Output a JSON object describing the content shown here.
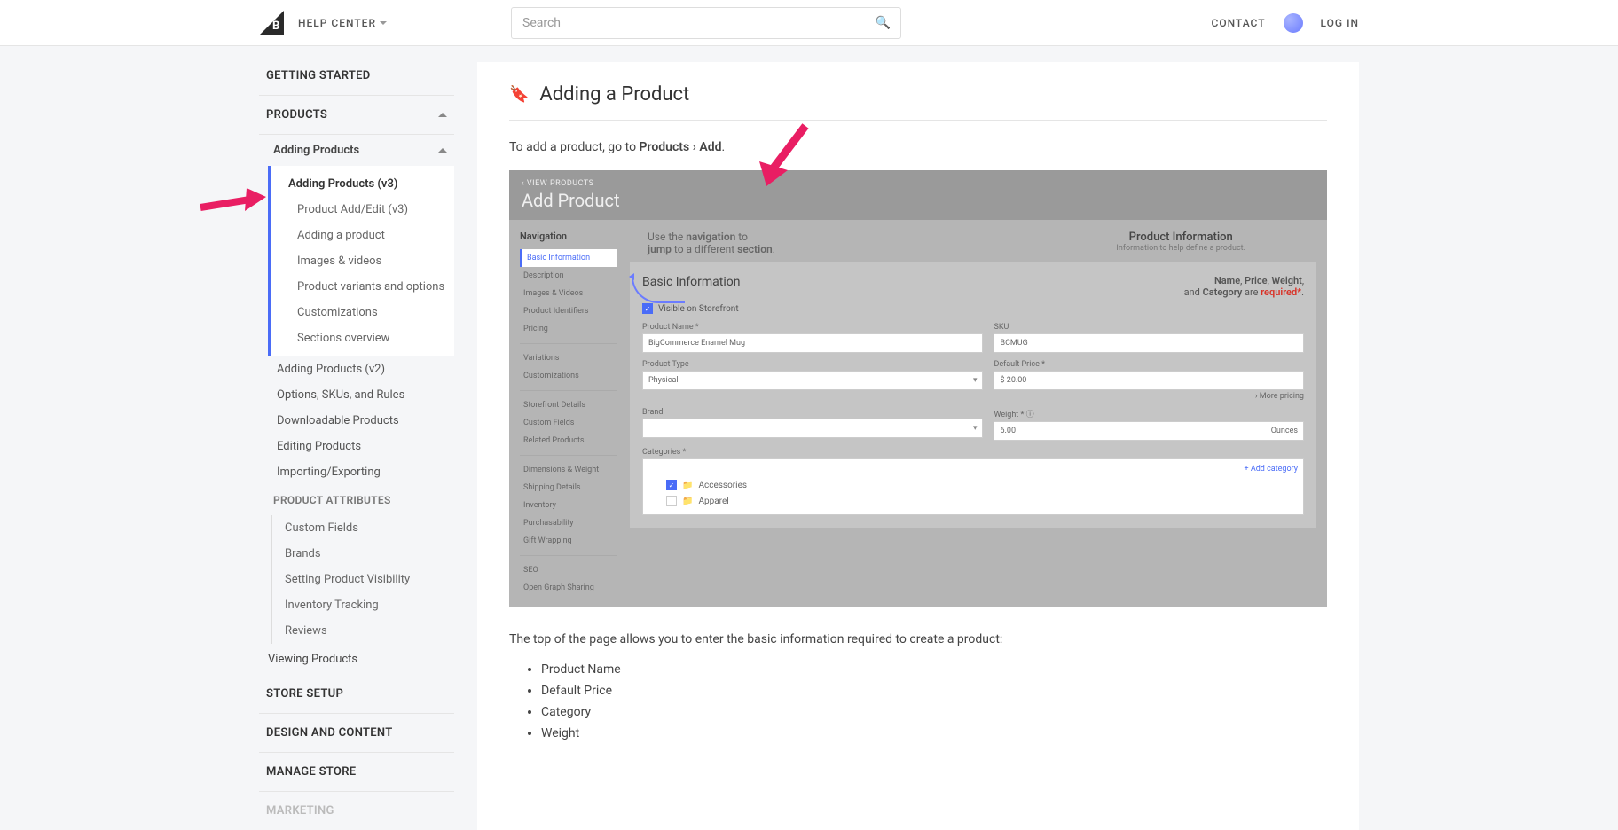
{
  "header": {
    "help_center": "HELP CENTER",
    "search_placeholder": "Search",
    "contact": "CONTACT",
    "login": "LOG IN"
  },
  "sidebar": {
    "getting_started": "GETTING STARTED",
    "products": "PRODUCTS",
    "adding_products": "Adding Products",
    "items_v3": {
      "adding_products_v3": "Adding Products (v3)",
      "product_add_edit": "Product Add/Edit (v3)",
      "adding_a_product": "Adding a product",
      "images_videos": "Images & videos",
      "product_variants": "Product variants and options",
      "customizations": "Customizations",
      "sections_overview": "Sections overview"
    },
    "adding_products_v2": "Adding Products (v2)",
    "options_skus": "Options, SKUs, and Rules",
    "downloadable": "Downloadable Products",
    "editing": "Editing Products",
    "importing": "Importing/Exporting",
    "product_attributes": "PRODUCT ATTRIBUTES",
    "attrs": {
      "custom_fields": "Custom Fields",
      "brands": "Brands",
      "visibility": "Setting Product Visibility",
      "inventory": "Inventory Tracking",
      "reviews": "Reviews"
    },
    "viewing_products": "Viewing Products",
    "store_setup": "STORE SETUP",
    "design_content": "DESIGN AND CONTENT",
    "manage_store": "MANAGE STORE",
    "marketing": "MARKETING"
  },
  "article": {
    "title": "Adding a Product",
    "intro_pre": "To add a product, go to ",
    "intro_b1": "Products",
    "intro_sep": " › ",
    "intro_b2": "Add",
    "intro_post": ".",
    "below": "The top of the page allows you to enter the basic information required to create a product:",
    "bullets": [
      "Product Name",
      "Default Price",
      "Category",
      "Weight"
    ]
  },
  "screenshot": {
    "back": "‹  VIEW PRODUCTS",
    "title": "Add Product",
    "nav_title": "Navigation",
    "nav_items": [
      "Basic Information",
      "Description",
      "Images & Videos",
      "Product Identifiers",
      "Pricing",
      "Variations",
      "Customizations",
      "Storefront Details",
      "Custom Fields",
      "Related Products",
      "Dimensions & Weight",
      "Shipping Details",
      "Inventory",
      "Purchasability",
      "Gift Wrapping",
      "SEO",
      "Open Graph Sharing"
    ],
    "hint1a": "Use the ",
    "hint1b": "navigation",
    "hint1c": " to",
    "hint2a": "jump",
    "hint2b": " to a different ",
    "hint2c": "section",
    "hint2d": ".",
    "pi_title": "Product Information",
    "pi_sub": "Information to help define a product.",
    "panel_title": "Basic Information",
    "req_name": "Name",
    "req_price": "Price",
    "req_weight": "Weight",
    "req_and": "and ",
    "req_category": "Category",
    "req_are": " are ",
    "req_required": "required*",
    "req_dot": ".",
    "visible": "Visible on Storefront",
    "fields": {
      "product_name_label": "Product Name *",
      "product_name_value": "BigCommerce Enamel Mug",
      "sku_label": "SKU",
      "sku_value": "BCMUG",
      "product_type_label": "Product Type",
      "product_type_value": "Physical",
      "default_price_label": "Default Price *",
      "default_price_value": "$ 20.00",
      "more_pricing": "›  More pricing",
      "brand_label": "Brand",
      "brand_value": "",
      "weight_label": "Weight * ⓘ",
      "weight_value": "6.00",
      "weight_unit": "Ounces",
      "categories_label": "Categories *",
      "add_category": "+  Add category",
      "cat1": "Accessories",
      "cat2": "Apparel"
    }
  }
}
